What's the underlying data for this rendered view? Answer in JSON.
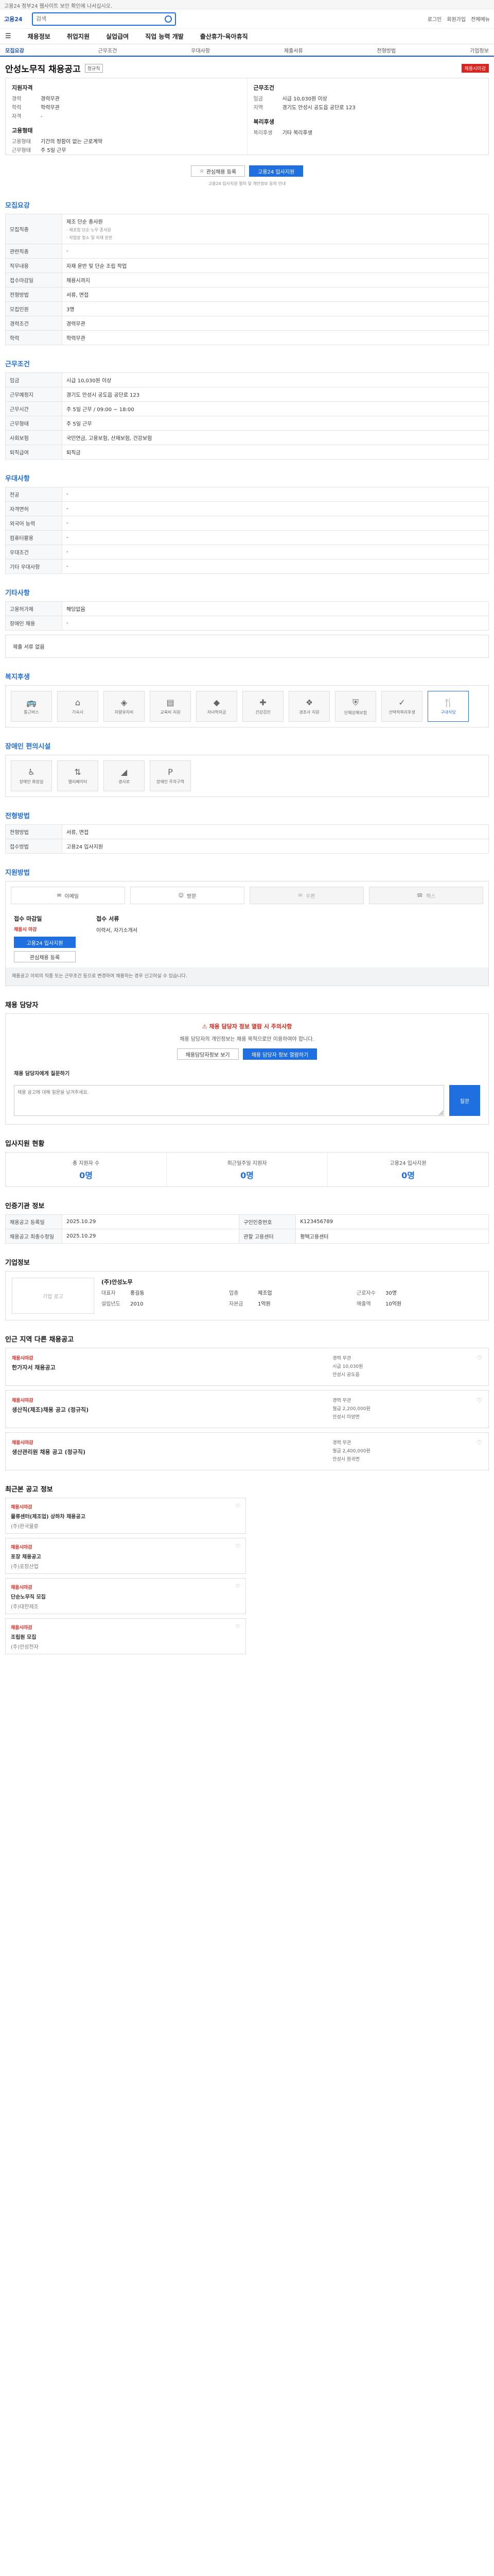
{
  "notice": "고용24 정부24 웹사이트 보안 확인에 나서십시오.",
  "logo": "고용24",
  "search": {
    "placeholder": "검색"
  },
  "util": [
    "로그인",
    "회원가입",
    "전체메뉴"
  ],
  "menu": [
    "채용정보",
    "취업지원",
    "실업급여",
    "직업 능력 개발",
    "출산휴가·육아휴직"
  ],
  "subnav": [
    "모집요강",
    "근무조건",
    "우대사항",
    "제출서류",
    "전형방법",
    "기업정보"
  ],
  "title": "안성노무직 채용공고",
  "badge": "정규직",
  "deadline_badge": "채용시마감",
  "summary": {
    "left_head": "지원자격",
    "left": [
      [
        "경력",
        "경력무관"
      ],
      [
        "학력",
        "학력무관"
      ],
      [
        "자격",
        "-"
      ]
    ],
    "left_head2": "고용형태",
    "left2": [
      [
        "고용형태",
        "기간의 정함이 없는 근로계약"
      ],
      [
        "근무형태",
        "주 5일 근무"
      ]
    ],
    "right_head": "근무조건",
    "right": [
      [
        "임금",
        "시급 10,030원 이상"
      ],
      [
        "지역",
        "경기도 안성시 공도읍 공단로 123"
      ]
    ],
    "right_head2": "복리후생",
    "right2": [
      [
        "복리후생",
        "기타 복리후생"
      ]
    ]
  },
  "buttons": {
    "fav": "관심채용 등록",
    "apply": "고용24 입사지원"
  },
  "apply_note": "고용24 입사지원 절차 및 개인정보 동의 안내",
  "recruit": {
    "title": "모집요강",
    "job_note1": "- 제조업 단순 노무 종사원",
    "job_note2": "- 작업장 청소 및 자재 운반",
    "rows": [
      [
        "모집직종",
        "제조 단순 종사원"
      ],
      [
        "관련직종",
        "-"
      ],
      [
        "직무내용",
        "자재 운반 및 단순 조립 작업"
      ],
      [
        "접수마감일",
        "채용시까지"
      ],
      [
        "전형방법",
        "서류, 면접"
      ],
      [
        "모집인원",
        "3명"
      ],
      [
        "경력조건",
        "경력무관"
      ],
      [
        "학력",
        "학력무관"
      ]
    ]
  },
  "work": {
    "title": "근무조건",
    "wage": "시급 10,030원 이상",
    "rows": [
      [
        "근무예정지",
        "경기도 안성시 공도읍 공단로 123"
      ],
      [
        "근무시간",
        "주 5일 근무 / 09:00 ~ 18:00"
      ],
      [
        "근무형태",
        "주 5일 근무"
      ],
      [
        "사회보험",
        "국민연금, 고용보험, 산재보험, 건강보험"
      ],
      [
        "퇴직급여",
        "퇴직금"
      ]
    ]
  },
  "prefer": {
    "title": "우대사항",
    "rows": [
      [
        "전공",
        "-"
      ],
      [
        "자격면허",
        "-"
      ],
      [
        "외국어 능력",
        "-"
      ],
      [
        "컴퓨터활용",
        "-"
      ],
      [
        "우대조건",
        "-"
      ],
      [
        "기타 우대사항",
        "-"
      ]
    ]
  },
  "etc": {
    "title": "기타사항",
    "rows": [
      [
        "고용허가제",
        "해당없음"
      ],
      [
        "장애인 채용",
        "-"
      ]
    ]
  },
  "docs_note": "제출 서류 없음",
  "welfare": {
    "title": "복지후생",
    "items": [
      "통근버스",
      "기숙사",
      "차량유지비",
      "교육비 지원",
      "자녀학자금",
      "건강검진",
      "경조사 지원",
      "단체상해보험",
      "선택적복리후생",
      "구내식당"
    ]
  },
  "disabled": {
    "title": "장애인 편의시설",
    "items": [
      "장애인 화장실",
      "엘리베이터",
      "경사로",
      "장애인 주차구역"
    ]
  },
  "selection": {
    "title": "전형방법",
    "rows": [
      [
        "전형방법",
        "서류, 면접"
      ],
      [
        "접수방법",
        "고용24 입사지원"
      ]
    ]
  },
  "apply_methods": {
    "title": "지원방법",
    "items": [
      "이메일",
      "방문",
      "우편",
      "팩스"
    ],
    "box_head": "접수 마감일",
    "box_val": "채용시 마감",
    "apply_btn": "고용24 입사지원",
    "fav_btn": "관심채용 등록",
    "doc_head": "접수 서류",
    "doc_val": "이력서, 자기소개서"
  },
  "caution": "채용공고 이외의 직종 또는 근무조건 등으로 변경하여 채용하는 경우 신고하실 수 있습니다.",
  "qa": {
    "title": "채용 담당자",
    "warn": "채용 담당자 정보 열람 시 주의사항",
    "desc": "채용 담당자의 개인정보는 채용 목적으로만 이용하여야 합니다.",
    "b1": "채용담당자정보 보기",
    "b2": "채용 담당자 정보 열람하기",
    "q_label": "채용 담당자에게 질문하기",
    "q_ph": "채용 공고에 대해 질문을 남겨주세요.",
    "q_btn": "질문"
  },
  "stats": {
    "title": "입사지원 현황",
    "items": [
      [
        "총 지원자 수",
        "0명"
      ],
      [
        "최근일주일 지원자",
        "0명"
      ],
      [
        "고용24 입사지원",
        "0명"
      ]
    ]
  },
  "job_info": {
    "title": "인증기관 정보",
    "rows": [
      [
        "채용공고 등록일",
        "2025.10.29"
      ],
      [
        "구인인증번호",
        "K123456789"
      ],
      [
        "채용공고 최종수정일",
        "2025.10.29"
      ],
      [
        "관할 고용센터",
        "평택고용센터"
      ]
    ]
  },
  "company": {
    "title": "기업정보",
    "logo": "기업 로고",
    "name": "(주)안성노무",
    "rows": [
      [
        "대표자",
        "홍길동"
      ],
      [
        "업종",
        "제조업"
      ],
      [
        "근로자수",
        "30명"
      ],
      [
        "설립년도",
        "2010"
      ],
      [
        "자본금",
        "1억원"
      ],
      [
        "매출액",
        "10억원"
      ]
    ]
  },
  "similar": {
    "title": "인근 지역 다른 채용공고",
    "items": [
      {
        "tag": "채용시마감",
        "name": "한가자서 채용공고",
        "info": [
          "경력 무관",
          "시급 10,030원",
          "안성시 공도읍"
        ]
      },
      {
        "tag": "채용시마감",
        "name": "생산직(제조)채용 공고 (정규직)",
        "info": [
          "경력 무관",
          "월급 2,200,000원",
          "안성시 미양면"
        ]
      },
      {
        "tag": "채용시마감",
        "name": "생산관리원 채용 공고 (정규직)",
        "info": [
          "경력 무관",
          "월급 2,400,000원",
          "안성시 원곡면"
        ]
      }
    ]
  },
  "recent": {
    "title": "최근본 공고 정보",
    "items": [
      {
        "tag": "채용시마감",
        "name": "물류센터(제조업) 상하차 채용공고",
        "co": "(주)한국물류"
      },
      {
        "tag": "채용시마감",
        "name": "포장 채용공고",
        "co": "(주)포장산업"
      },
      {
        "tag": "채용시마감",
        "name": "단순노무직 모집",
        "co": "(주)대한제조"
      },
      {
        "tag": "채용시마감",
        "name": "조립원 모집",
        "co": "(주)안성전자"
      }
    ]
  }
}
